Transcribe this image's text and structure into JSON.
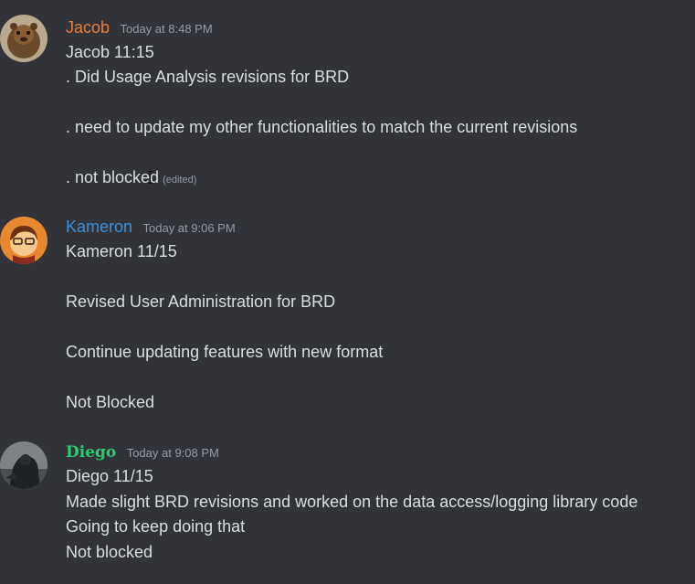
{
  "messages": [
    {
      "author": "Jacob",
      "author_color": "#e67e3a",
      "timestamp": "Today at 8:48 PM",
      "lines": [
        ". Did Usage Analysis revisions for BRD",
        ". need to update my other functionalities to match the current revisions",
        ". not blocked"
      ],
      "title_line": "Jacob 11:15",
      "edited_label": "(edited)"
    },
    {
      "author": "Kameron",
      "author_color": "#3f8fd6",
      "timestamp": "Today at 9:06 PM",
      "title_line": "Kameron 11/15",
      "lines": [
        "Revised User Administration for BRD",
        "Continue updating features with new format",
        "Not Blocked"
      ]
    },
    {
      "author": "Diego",
      "author_color": "#2ecc71",
      "timestamp": "Today at 9:08 PM",
      "title_line": "Diego 11/15",
      "lines": [
        "Made slight BRD revisions and worked on the data access/logging library code",
        "Going to keep doing that",
        "Not blocked"
      ]
    }
  ]
}
